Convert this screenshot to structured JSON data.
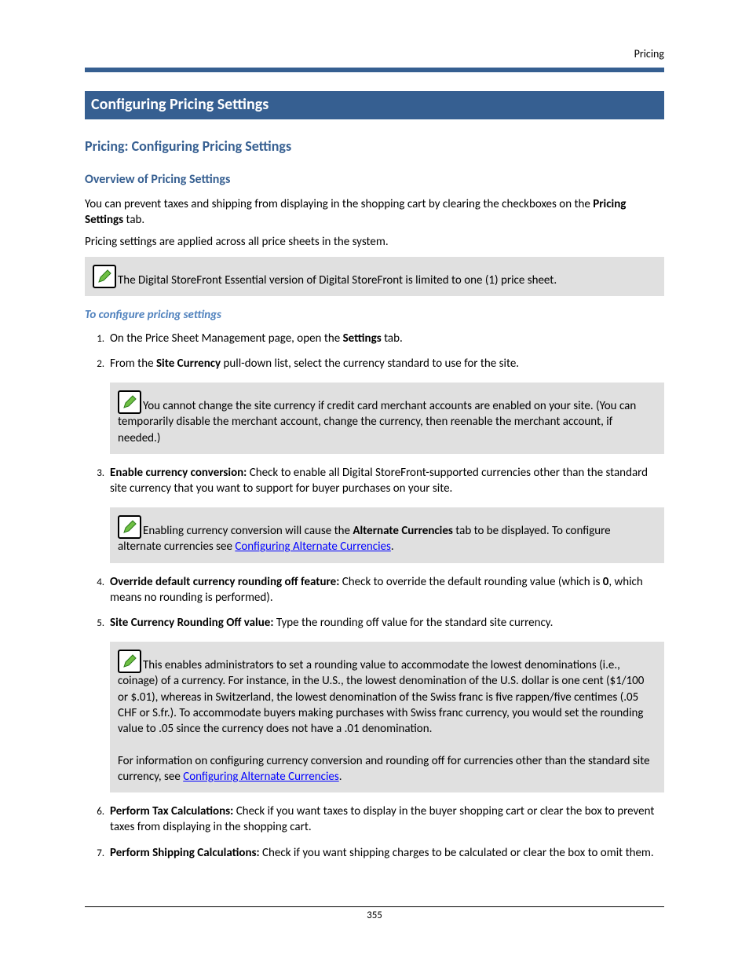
{
  "header": {
    "right": "Pricing"
  },
  "h1": "Configuring Pricing Settings",
  "h2": "Pricing: Configuring Pricing Settings",
  "h3_overview": "Overview of Pricing Settings",
  "p_overview_1a": "You can prevent taxes and shipping from displaying in the shopping cart by clearing the checkboxes on the ",
  "p_overview_1b": "Pricing Settings",
  "p_overview_1c": " tab.",
  "p_overview_2": "Pricing settings are applied across all price sheets in the system.",
  "note1": "The Digital StoreFront Essential version of Digital StoreFront is limited to one (1) price sheet.",
  "h4_config": "To configure pricing settings",
  "steps": {
    "s1a": "On the Price Sheet Management page, open the ",
    "s1b": "Settings",
    "s1c": " tab.",
    "s2a": "From the ",
    "s2b": "Site Currency",
    "s2c": " pull-down list, select the currency standard to use for the site.",
    "s2_note": "You cannot change the site currency if credit card merchant accounts are enabled on your site. (You can temporarily disable the merchant account, change the currency, then reenable the merchant account, if needed.)",
    "s3a": "Enable currency conversion:",
    "s3b": " Check to enable all Digital StoreFront-supported currencies other than the standard site currency that you want to support for buyer purchases on your site.",
    "s3_note_a": "Enabling currency conversion will cause the ",
    "s3_note_b": "Alternate Currencies",
    "s3_note_c": " tab to be displayed. To configure alternate currencies see ",
    "s3_note_link": "Configuring Alternate Currencies",
    "s3_note_d": ".",
    "s4a": "Override default currency rounding off feature:",
    "s4b": " Check to override the default rounding value (which is ",
    "s4c": "0",
    "s4d": ", which means no rounding is performed).",
    "s5a": "Site Currency Rounding Off value:",
    "s5b": " Type the rounding off value for the standard site currency.",
    "s5_note1": "This enables administrators to set a rounding value to accommodate the lowest denominations (i.e., coinage) of a currency. For instance, in the U.S., the lowest denomination of the U.S. dollar is one cent ($1/100 or $.01), whereas in Switzerland, the lowest denomination of the Swiss franc is five rappen/five centimes (.05 CHF or S.fr.). To accommodate buyers making purchases with Swiss franc currency, you would set the rounding value to .05 since the currency does not have a .01 denomination.",
    "s5_note2a": "For information on configuring currency conversion and rounding off for currencies other than the standard site currency, see ",
    "s5_note2_link": "Configuring Alternate Currencies",
    "s5_note2b": ".",
    "s6a": "Perform Tax Calculations:",
    "s6b": " Check if you want taxes to display in the buyer shopping cart or clear the box to prevent taxes from displaying in the shopping cart.",
    "s7a": "Perform Shipping Calculations:",
    "s7b": " Check if you want shipping charges to be calculated or clear the box to omit them."
  },
  "footer_page": "355"
}
